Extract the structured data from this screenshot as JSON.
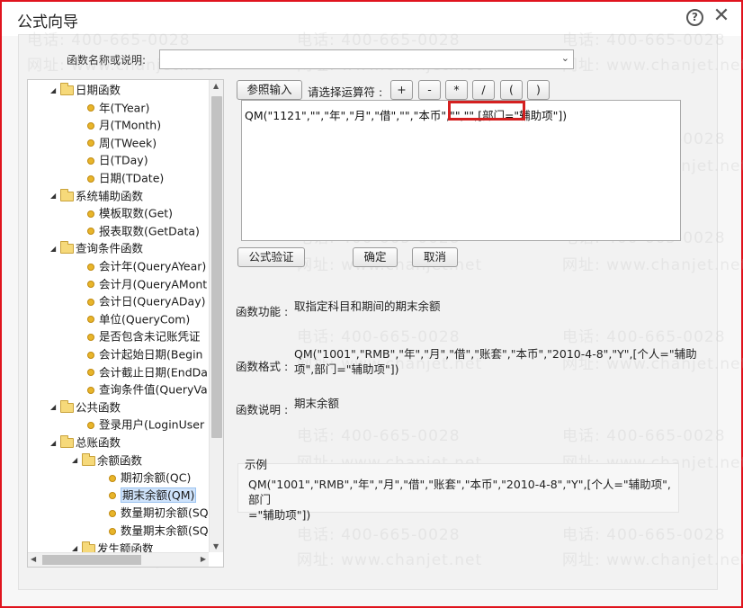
{
  "window": {
    "title": "公式向导"
  },
  "search": {
    "label": "函数名称或说明:",
    "value": ""
  },
  "tree": {
    "items": [
      {
        "label": "日期函数",
        "type": "folder"
      },
      {
        "label": "年(TYear)",
        "type": "leaf"
      },
      {
        "label": "月(TMonth)",
        "type": "leaf"
      },
      {
        "label": "周(TWeek)",
        "type": "leaf"
      },
      {
        "label": "日(TDay)",
        "type": "leaf"
      },
      {
        "label": "日期(TDate)",
        "type": "leaf"
      },
      {
        "label": "系统辅助函数",
        "type": "folder"
      },
      {
        "label": "模板取数(Get)",
        "type": "leaf"
      },
      {
        "label": "报表取数(GetData)",
        "type": "leaf"
      },
      {
        "label": "查询条件函数",
        "type": "folder"
      },
      {
        "label": "会计年(QueryAYear)",
        "type": "leaf"
      },
      {
        "label": "会计月(QueryAMont",
        "type": "leaf"
      },
      {
        "label": "会计日(QueryADay)",
        "type": "leaf"
      },
      {
        "label": "单位(QueryCom)",
        "type": "leaf"
      },
      {
        "label": "是否包含未记账凭证",
        "type": "leaf"
      },
      {
        "label": "会计起始日期(Begin",
        "type": "leaf"
      },
      {
        "label": "会计截止日期(EndDa",
        "type": "leaf"
      },
      {
        "label": "查询条件值(QueryVa",
        "type": "leaf"
      },
      {
        "label": "公共函数",
        "type": "folder"
      },
      {
        "label": "登录用户(LoginUser",
        "type": "leaf"
      },
      {
        "label": "总账函数",
        "type": "folder"
      },
      {
        "label": "余额函数",
        "type": "folder"
      },
      {
        "label": "期初余额(QC)",
        "type": "leaf"
      },
      {
        "label": "期末余额(QM)",
        "type": "leaf",
        "selected": true
      },
      {
        "label": "数量期初余额(SQ",
        "type": "leaf"
      },
      {
        "label": "数量期末余额(SQ",
        "type": "leaf"
      },
      {
        "label": "发生额函数",
        "type": "folder"
      }
    ]
  },
  "toolbar": {
    "reference_input": "参照输入",
    "operator_label": "请选择运算符 :",
    "operators": [
      "+",
      "-",
      "*",
      "/",
      "(",
      ")"
    ]
  },
  "formula": {
    "value": "QM(\"1121\",\"\",\"年\",\"月\",\"借\",\"\",\"本币\",\"\",\"\",[部门=\"辅助项\"])"
  },
  "actions": {
    "validate": "公式验证",
    "ok": "确定",
    "cancel": "取消"
  },
  "info": {
    "function_label": "函数功能 :",
    "function_text": "取指定科目和期间的期末余额",
    "format_label": "函数格式 :",
    "format_line1": "QM(\"1001\",\"RMB\",\"年\",\"月\",\"借\",\"账套\",\"本币\",\"2010-4-8\",\"Y\",[个人=\"辅助",
    "format_line2": "项\",部门=\"辅助项\"])",
    "desc_label": "函数说明 :",
    "desc_text": "期末余额"
  },
  "example": {
    "label": "示例",
    "line1": "QM(\"1001\",\"RMB\",\"年\",\"月\",\"借\",\"账套\",\"本币\",\"2010-4-8\",\"Y\",[个人=\"辅助项\",部门",
    "line2": "=\"辅助项\"])"
  },
  "watermark": {
    "phone": "电话: 400-665-0028",
    "site": "网址: www.chanjet.net"
  }
}
